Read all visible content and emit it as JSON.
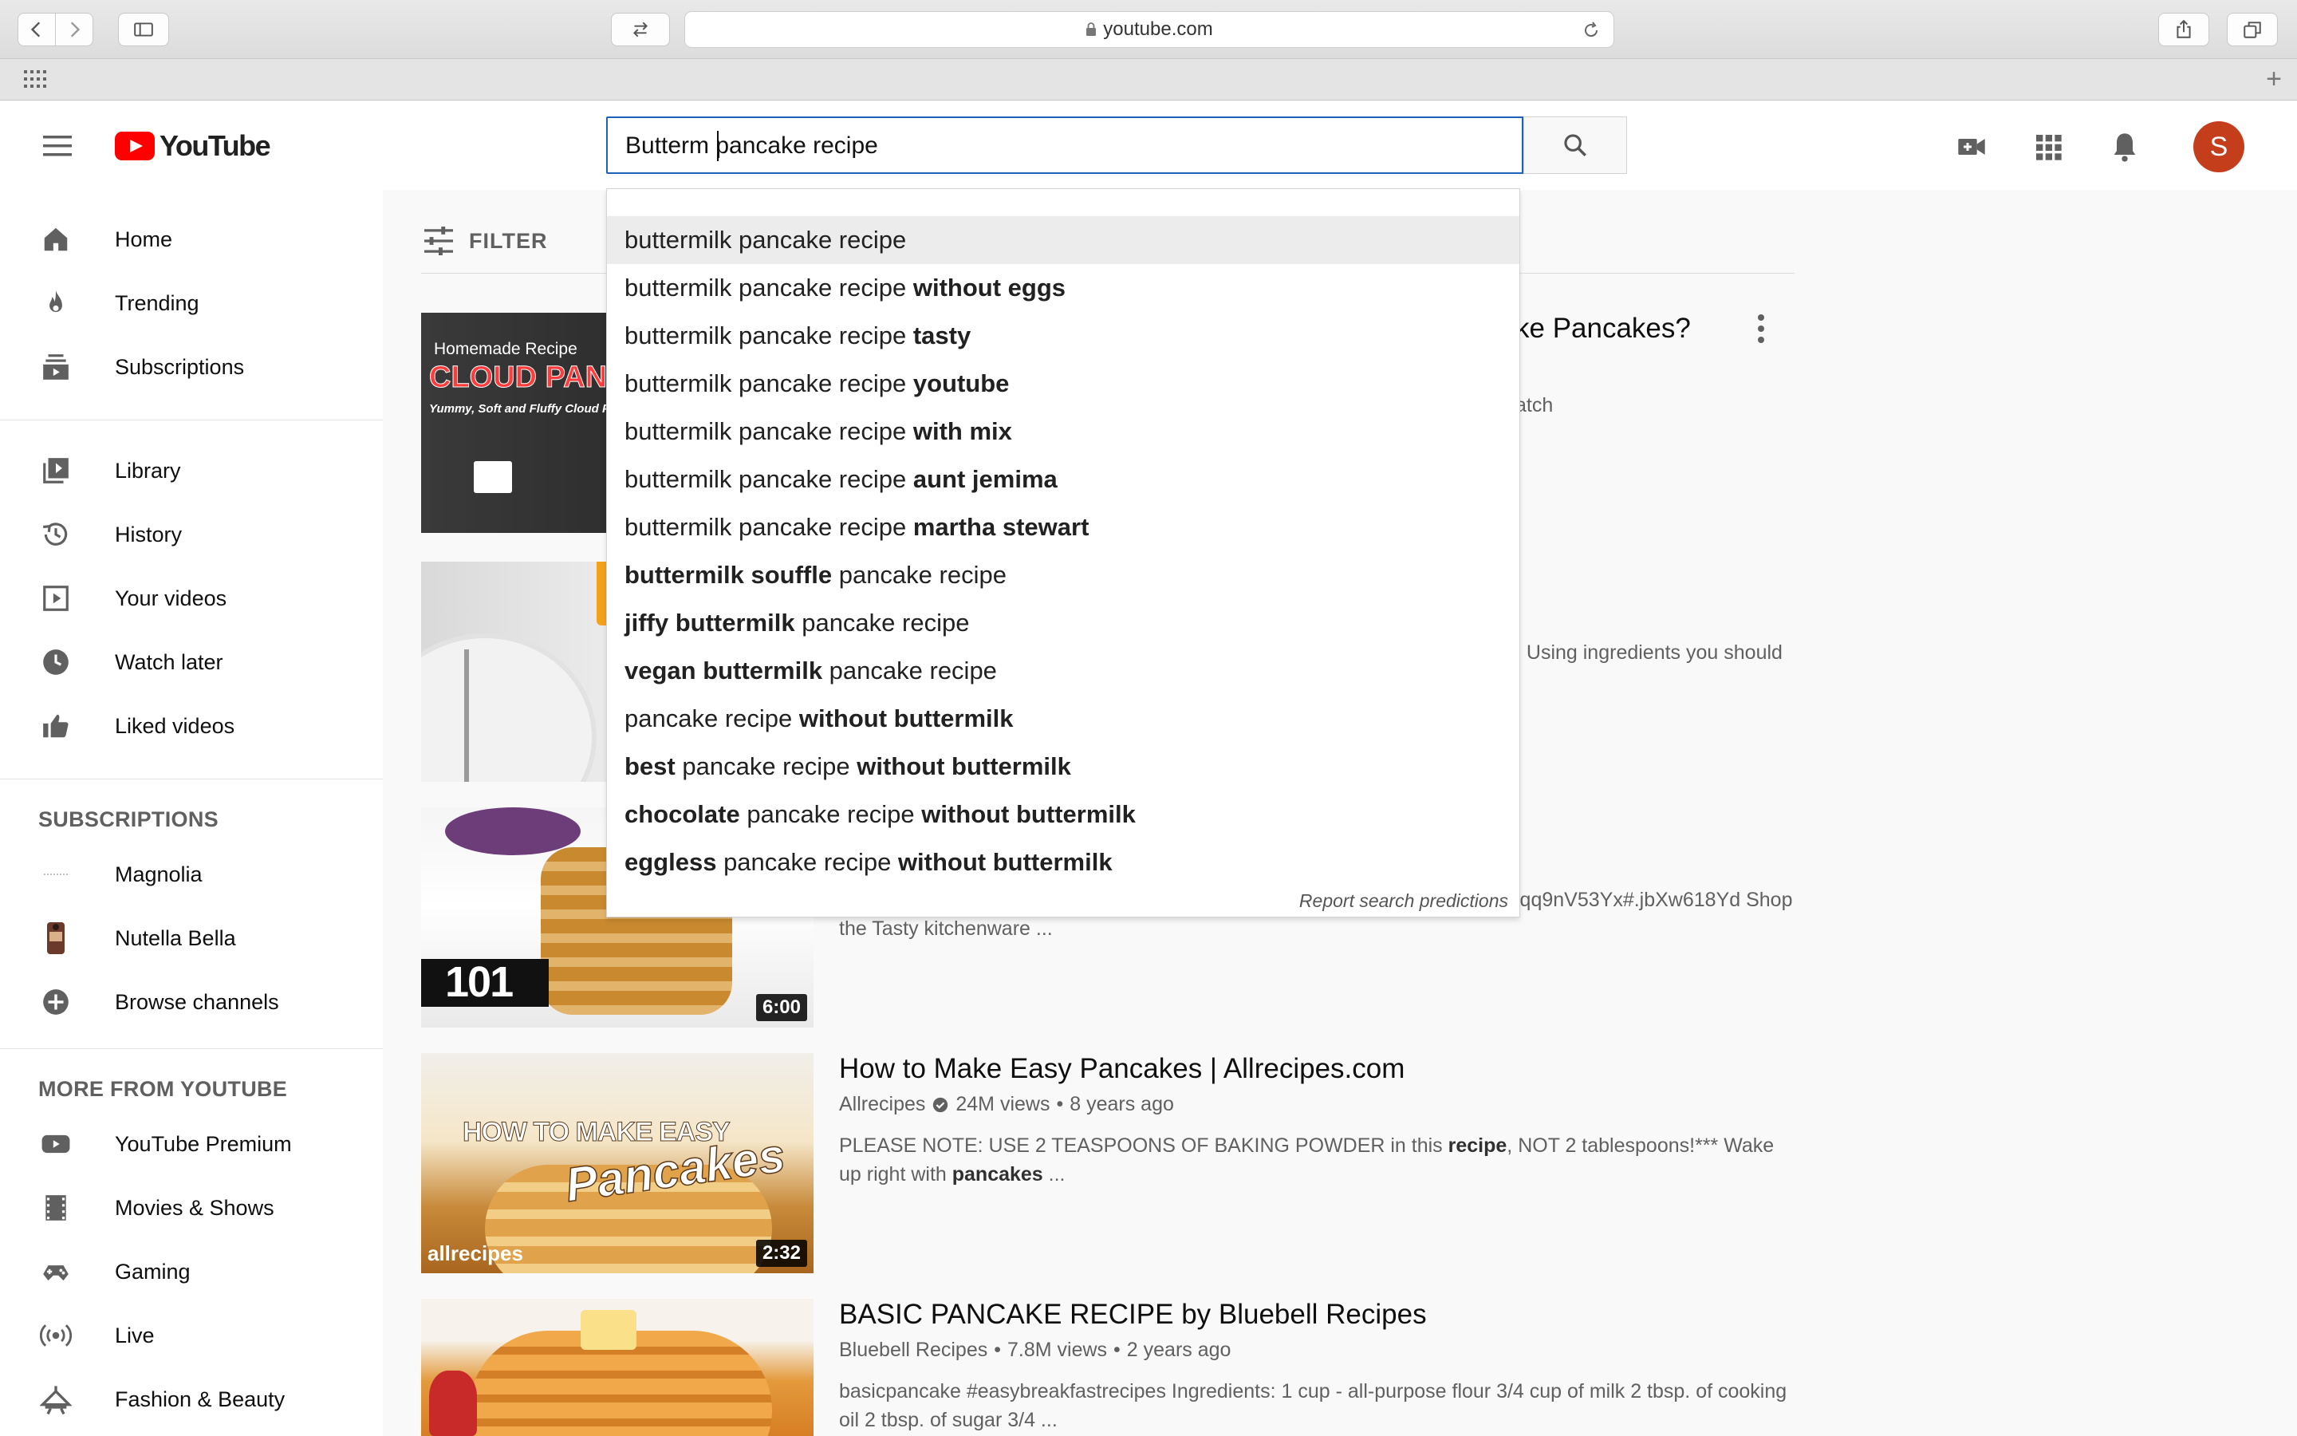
{
  "browser": {
    "url": "youtube.com"
  },
  "header": {
    "logo_text": "YouTube",
    "search_value": "Butterm pancake recipe",
    "avatar_letter": "S"
  },
  "sidebar": {
    "primary": [
      {
        "label": "Home",
        "icon": "home-icon"
      },
      {
        "label": "Trending",
        "icon": "flame-icon"
      },
      {
        "label": "Subscriptions",
        "icon": "subscriptions-icon"
      }
    ],
    "library": [
      {
        "label": "Library",
        "icon": "library-icon"
      },
      {
        "label": "History",
        "icon": "history-icon"
      },
      {
        "label": "Your videos",
        "icon": "play-square-icon"
      },
      {
        "label": "Watch later",
        "icon": "clock-icon"
      },
      {
        "label": "Liked videos",
        "icon": "thumbs-up-icon"
      }
    ],
    "subscriptions_heading": "SUBSCRIPTIONS",
    "subscriptions": [
      {
        "label": "Magnolia"
      },
      {
        "label": "Nutella Bella"
      },
      {
        "label": "Browse channels"
      }
    ],
    "more_heading": "MORE FROM YOUTUBE",
    "more": [
      {
        "label": "YouTube Premium",
        "icon": "youtube-icon"
      },
      {
        "label": "Movies & Shows",
        "icon": "film-icon"
      },
      {
        "label": "Gaming",
        "icon": "gamepad-icon"
      },
      {
        "label": "Live",
        "icon": "live-icon"
      },
      {
        "label": "Fashion & Beauty",
        "icon": "hanger-icon"
      }
    ]
  },
  "filter": {
    "label": "FILTER"
  },
  "results": [
    {
      "title_visible": "ke Pancakes?",
      "meta_visible": "atch",
      "thumb_text_1": "Homemade Recipe",
      "thumb_text_2": "CLOUD PAN",
      "thumb_text_3": "Yummy, Soft and Fluffy Cloud Pa"
    },
    {
      "desc_visible": ". Using ingredients you should"
    },
    {
      "desc_line1_visible": "jqq9nV53Yx#.jbXw618Yd Shop",
      "desc_line2": "the Tasty kitchenware ...",
      "thumb_text": "101",
      "duration": "6:00"
    },
    {
      "title": "How to Make Easy Pancakes | Allrecipes.com",
      "channel": "Allrecipes",
      "views": "24M views",
      "age": "8 years ago",
      "desc_pre": "PLEASE NOTE: USE 2 TEASPOONS OF BAKING POWDER in this ",
      "desc_b1": "recipe",
      "desc_mid": ", NOT 2 tablespoons!*** Wake up right with ",
      "desc_b2": "pancakes",
      "desc_post": " ...",
      "thumb_text_1": "HOW TO MAKE EASY",
      "thumb_text_2": "Pancakes",
      "thumb_brand": "allrecipes",
      "duration": "2:32"
    },
    {
      "title": "BASIC PANCAKE RECIPE by Bluebell Recipes",
      "channel": "Bluebell Recipes",
      "views": "7.8M views",
      "age": "2 years ago",
      "desc": "basicpancake #easybreakfastrecipes Ingredients: 1 cup - all-purpose flour 3/4 cup of milk 2 tbsp. of cooking oil 2 tbsp. of sugar 3/4 ..."
    }
  ],
  "suggestions": [
    [
      {
        "t": "buttermilk",
        "b": false
      },
      {
        "t": " pancake recipe",
        "b": false
      }
    ],
    [
      {
        "t": "buttermilk",
        "b": false
      },
      {
        "t": " pancake recipe ",
        "b": false
      },
      {
        "t": "without eggs",
        "b": true
      }
    ],
    [
      {
        "t": "buttermilk",
        "b": false
      },
      {
        "t": " pancake recipe ",
        "b": false
      },
      {
        "t": "tasty",
        "b": true
      }
    ],
    [
      {
        "t": "buttermilk",
        "b": false
      },
      {
        "t": " pancake recipe ",
        "b": false
      },
      {
        "t": "youtube",
        "b": true
      }
    ],
    [
      {
        "t": "buttermilk",
        "b": false
      },
      {
        "t": " pancake recipe ",
        "b": false
      },
      {
        "t": "with mix",
        "b": true
      }
    ],
    [
      {
        "t": "buttermilk",
        "b": false
      },
      {
        "t": " pancake recipe ",
        "b": false
      },
      {
        "t": "aunt jemima",
        "b": true
      }
    ],
    [
      {
        "t": "buttermilk",
        "b": false
      },
      {
        "t": " pancake recipe ",
        "b": false
      },
      {
        "t": "martha stewart",
        "b": true
      }
    ],
    [
      {
        "t": "buttermilk souffle",
        "b": true
      },
      {
        "t": " pancake recipe",
        "b": false
      }
    ],
    [
      {
        "t": "jiffy buttermilk",
        "b": true
      },
      {
        "t": " pancake recipe",
        "b": false
      }
    ],
    [
      {
        "t": "vegan buttermilk",
        "b": true
      },
      {
        "t": " pancake recipe",
        "b": false
      }
    ],
    [
      {
        "t": "pancake recipe ",
        "b": false
      },
      {
        "t": "without buttermilk",
        "b": true
      }
    ],
    [
      {
        "t": "best",
        "b": true
      },
      {
        "t": " pancake recipe ",
        "b": false
      },
      {
        "t": "without buttermilk",
        "b": true
      }
    ],
    [
      {
        "t": "chocolate",
        "b": true
      },
      {
        "t": " pancake recipe ",
        "b": false
      },
      {
        "t": "without buttermilk",
        "b": true
      }
    ],
    [
      {
        "t": "eggless",
        "b": true
      },
      {
        "t": " pancake recipe ",
        "b": false
      },
      {
        "t": "without buttermilk",
        "b": true
      }
    ]
  ],
  "report_label": "Report search predictions",
  "colors": {
    "brand_red": "#ff0000",
    "search_focus": "#1c62b9",
    "avatar": "#c43e1c"
  }
}
